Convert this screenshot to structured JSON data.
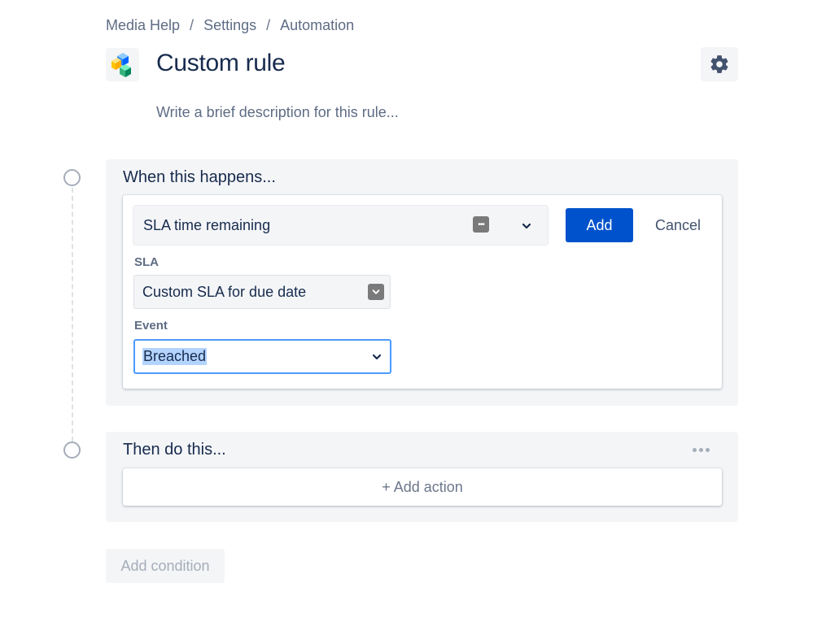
{
  "breadcrumb": {
    "items": [
      "Media Help",
      "Settings",
      "Automation"
    ],
    "separator": "/"
  },
  "header": {
    "title": "Custom rule",
    "icon": "rule-cubes-icon",
    "settings_icon": "gear-icon"
  },
  "description_placeholder": "Write a brief description for this rule...",
  "trigger_panel": {
    "title": "When this happens...",
    "trigger_value": "SLA time remaining",
    "add_label": "Add",
    "cancel_label": "Cancel",
    "sla_label": "SLA",
    "sla_value": "Custom SLA for due date",
    "event_label": "Event",
    "event_value": "Breached"
  },
  "action_panel": {
    "title": "Then do this...",
    "add_action_label": "+ Add action"
  },
  "add_condition_label": "Add condition",
  "colors": {
    "primary": "#0052CC",
    "panel_bg": "#F4F5F7",
    "focus_border": "#4C9AFF",
    "text": "#172B4D"
  }
}
